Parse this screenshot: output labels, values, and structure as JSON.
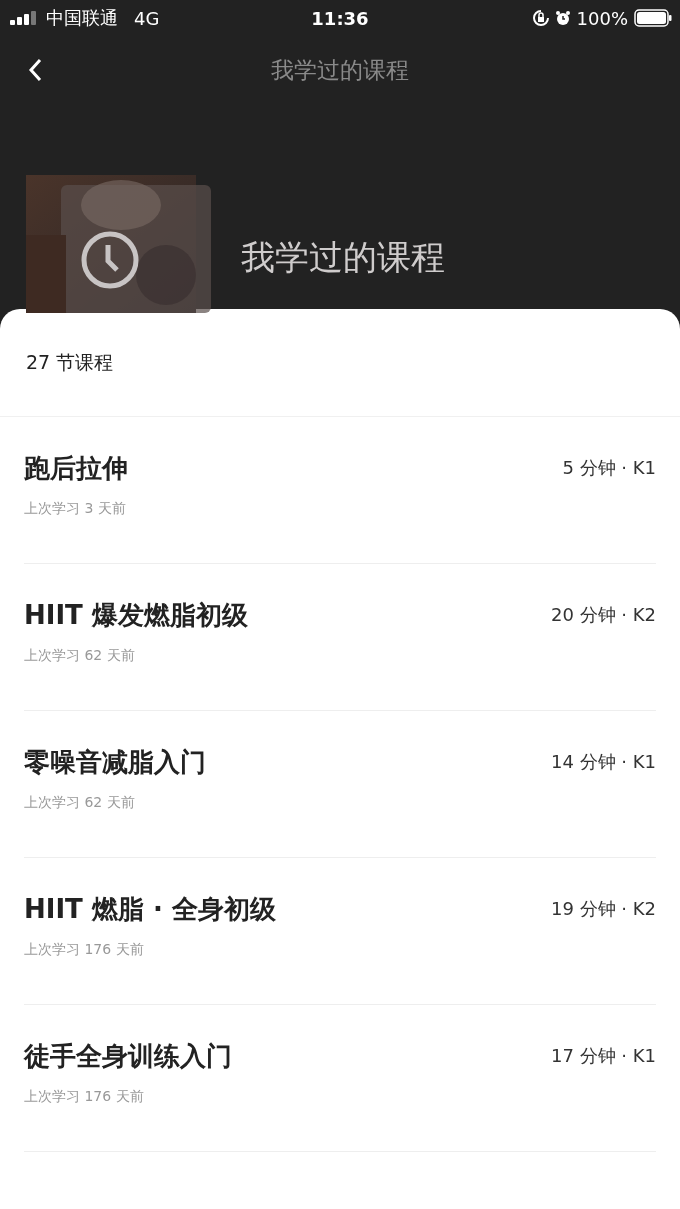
{
  "status_bar": {
    "carrier": "中国联通",
    "network": "4G",
    "time": "11:36",
    "battery": "100%"
  },
  "nav": {
    "title": "我学过的课程"
  },
  "header": {
    "title": "我学过的课程"
  },
  "count": "27 节课程",
  "courses": [
    {
      "title": "跑后拉伸",
      "meta": "5 分钟 · K1",
      "last": "上次学习 3 天前"
    },
    {
      "title": "HIIT 爆发燃脂初级",
      "meta": "20 分钟 · K2",
      "last": "上次学习 62 天前"
    },
    {
      "title": "零噪音减脂入门",
      "meta": "14 分钟 · K1",
      "last": "上次学习 62 天前"
    },
    {
      "title": "HIIT 燃脂 · 全身初级",
      "meta": "19 分钟 · K2",
      "last": "上次学习 176 天前"
    },
    {
      "title": "徒手全身训练入门",
      "meta": "17 分钟 · K1",
      "last": "上次学习 176 天前"
    }
  ]
}
